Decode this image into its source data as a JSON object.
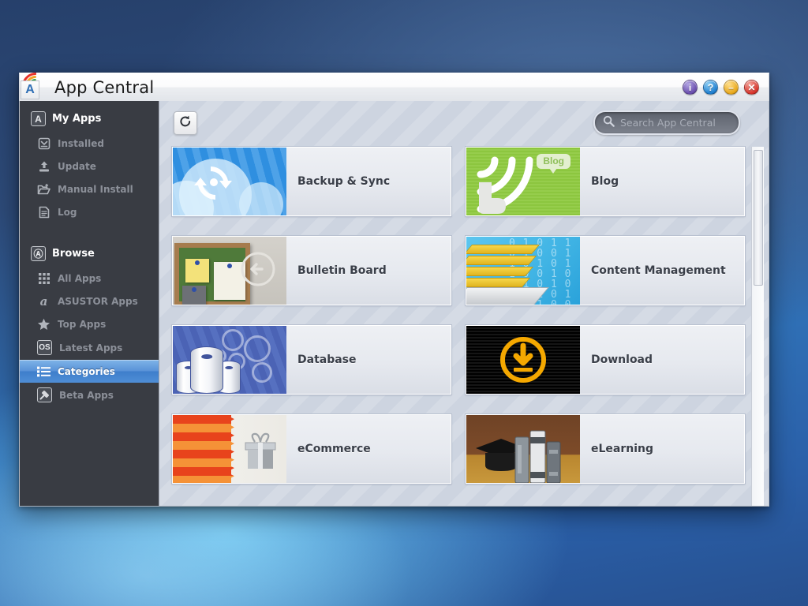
{
  "window": {
    "title": "App Central",
    "app_icon": "asustor-rainbow-a-icon",
    "icon_letter": "A",
    "buttons": [
      {
        "name": "info-button",
        "glyph": "i",
        "color": "#6b4fae"
      },
      {
        "name": "help-button",
        "glyph": "?",
        "color": "#1f7fd0"
      },
      {
        "name": "minimize-button",
        "glyph": "–",
        "color": "#e8a81c"
      },
      {
        "name": "close-button",
        "glyph": "✕",
        "color": "#d8342b"
      }
    ]
  },
  "sidebar": {
    "groups": [
      {
        "title": "My Apps",
        "icon": "boxed-a-icon",
        "items": [
          {
            "label": "Installed",
            "icon": "inbox-download-icon",
            "active": false
          },
          {
            "label": "Update",
            "icon": "upload-arrow-icon",
            "active": false
          },
          {
            "label": "Manual Install",
            "icon": "folder-plus-icon",
            "active": false
          },
          {
            "label": "Log",
            "icon": "document-lines-icon",
            "active": false
          }
        ]
      },
      {
        "title": "Browse",
        "icon": "boxed-circle-a-icon",
        "items": [
          {
            "label": "All Apps",
            "icon": "grid-dots-icon",
            "active": false
          },
          {
            "label": "ASUSTOR Apps",
            "icon": "at-a-icon",
            "active": false
          },
          {
            "label": "Top Apps",
            "icon": "star-icon",
            "active": false
          },
          {
            "label": "Latest Apps",
            "icon": "os-badge-icon",
            "active": false
          },
          {
            "label": "Categories",
            "icon": "list-bullets-icon",
            "active": true
          },
          {
            "label": "Beta Apps",
            "icon": "hammer-icon",
            "active": false
          }
        ]
      }
    ]
  },
  "toolbar": {
    "refresh_icon": "refresh-icon",
    "refresh_label": "Refresh"
  },
  "search": {
    "icon": "search-icon",
    "placeholder": "Search App Central",
    "value": ""
  },
  "categories": [
    {
      "label": "Backup & Sync",
      "thumb": "cloud-sync-icon",
      "accent": "#2f8fe0"
    },
    {
      "label": "Blog",
      "thumb": "rss-blog-icon",
      "accent": "#8cc63f",
      "bubble": "Blog"
    },
    {
      "label": "Bulletin Board",
      "thumb": "corkboard-notes-icon",
      "accent": "#a67c4e"
    },
    {
      "label": "Content Management",
      "thumb": "file-drawer-binary-icon",
      "accent": "#3fb3e4"
    },
    {
      "label": "Database",
      "thumb": "database-cylinders-icon",
      "accent": "#4b63b5"
    },
    {
      "label": "Download",
      "thumb": "download-circle-icon",
      "accent": "#f5a800"
    },
    {
      "label": "eCommerce",
      "thumb": "gift-box-icon",
      "accent": "#e8431c"
    },
    {
      "label": "eLearning",
      "thumb": "graduation-books-icon",
      "accent": "#7d4b29"
    }
  ],
  "scrollbar": {
    "name": "vertical-scrollbar",
    "thumb_top_pct": 2,
    "thumb_height_pct": 36
  },
  "colors": {
    "sidebar_bg": "#393c43",
    "content_bg": "#cdd4e0",
    "active_item": "#4f8ed6",
    "desktop": "#2f6fb5"
  }
}
